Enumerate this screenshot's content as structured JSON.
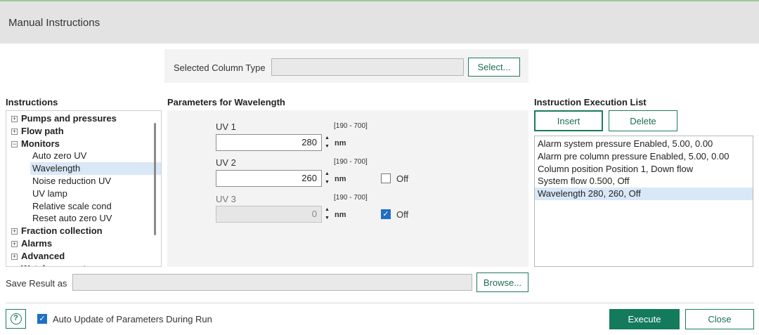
{
  "window": {
    "title": "Manual Instructions"
  },
  "column_type": {
    "label": "Selected Column Type",
    "value": "",
    "select_label": "Select..."
  },
  "instructions": {
    "heading": "Instructions",
    "tree": [
      {
        "label": "Pumps and pressures",
        "type": "group",
        "expander": "⊞"
      },
      {
        "label": "Flow path",
        "type": "group",
        "expander": "⊞"
      },
      {
        "label": "Monitors",
        "type": "group",
        "expander": "⊟"
      },
      {
        "label": "Auto zero UV",
        "type": "child"
      },
      {
        "label": "Wavelength",
        "type": "child",
        "selected": true
      },
      {
        "label": "Noise reduction UV",
        "type": "child"
      },
      {
        "label": "UV lamp",
        "type": "child"
      },
      {
        "label": "Relative scale cond",
        "type": "child"
      },
      {
        "label": "Reset auto zero UV",
        "type": "child"
      },
      {
        "label": "Fraction collection",
        "type": "group",
        "expander": "⊞"
      },
      {
        "label": "Alarms",
        "type": "group",
        "expander": "⊞"
      },
      {
        "label": "Advanced",
        "type": "group",
        "expander": "⊞"
      },
      {
        "label": "Watch parameters",
        "type": "group",
        "expander": "⊞"
      }
    ]
  },
  "parameters": {
    "heading": "Parameters for Wavelength",
    "uv": [
      {
        "label": "UV 1",
        "range": "[190 - 700]",
        "value": "280",
        "unit": "nm",
        "has_off": false,
        "off_checked": false,
        "disabled": false
      },
      {
        "label": "UV 2",
        "range": "[190 - 700]",
        "value": "260",
        "unit": "nm",
        "has_off": true,
        "off_label": "Off",
        "off_checked": false,
        "disabled": false
      },
      {
        "label": "UV 3",
        "range": "[190 - 700]",
        "value": "0",
        "unit": "nm",
        "has_off": true,
        "off_label": "Off",
        "off_checked": true,
        "disabled": true
      }
    ]
  },
  "execution": {
    "heading": "Instruction Execution List",
    "insert_label": "Insert",
    "delete_label": "Delete",
    "items": [
      {
        "text": "Alarm system pressure Enabled, 5.00, 0.00",
        "selected": false
      },
      {
        "text": "Alarm pre column pressure Enabled, 5.00, 0.00",
        "selected": false
      },
      {
        "text": "Column position Position 1, Down flow",
        "selected": false
      },
      {
        "text": "System flow 0.500, Off",
        "selected": false
      },
      {
        "text": "Wavelength 280, 260, Off",
        "selected": true
      }
    ]
  },
  "save_result": {
    "label": "Save Result as",
    "value": "",
    "browse_label": "Browse..."
  },
  "footer": {
    "auto_update_label": "Auto Update of Parameters During Run",
    "auto_update_checked": true,
    "execute_label": "Execute",
    "close_label": "Close",
    "help_icon": "help-circle-icon"
  },
  "colors": {
    "accent": "#147a5c",
    "selection": "#d9e8f7",
    "checkbox": "#1f6fc5"
  }
}
